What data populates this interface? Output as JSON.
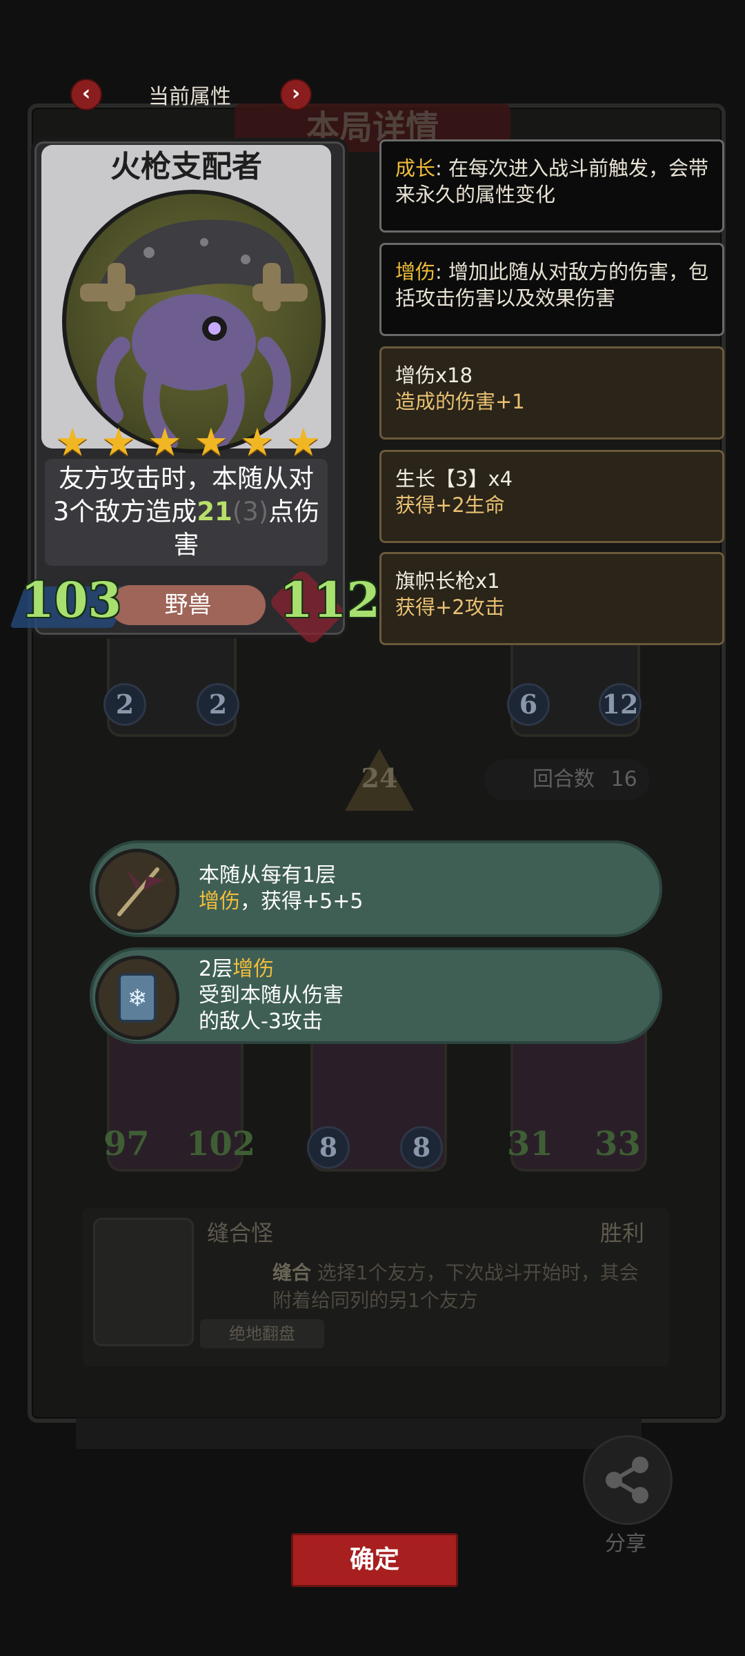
{
  "header": {
    "title": "当前属性",
    "prev_icon": "chevron-left-icon",
    "next_icon": "chevron-right-icon"
  },
  "background": {
    "banner_title": "本局详情",
    "round_label": "回合数",
    "round_value": "16",
    "tier_value": "24",
    "top_left_unit": {
      "attack": "2",
      "health": "2"
    },
    "top_right_unit": {
      "attack": "6",
      "health": "12"
    },
    "bottom_units": [
      {
        "attack": "97",
        "health": "102"
      },
      {
        "attack": "8",
        "health": "8"
      },
      {
        "attack": "31",
        "health": "33"
      }
    ],
    "opponent_name": "缝合怪",
    "result": "胜利",
    "ability_name": "缝合",
    "ability_desc": "选择1个友方，下次战斗开始时，其会附着给同列的另1个友方",
    "tag": "绝地翻盘"
  },
  "card": {
    "name": "火枪支配者",
    "stars": 6,
    "desc_line1": "友方攻击时，本随从对",
    "desc_line2_a": "3个敌方造成",
    "desc_line2_value": "21",
    "desc_line2_base": "(3)",
    "desc_line2_b": "点伤",
    "desc_line3": "害",
    "attack": "103",
    "health": "112",
    "tribe": "野兽"
  },
  "panels": [
    {
      "key": "成长",
      "text": ": 在每次进入战斗前触发，会带来永久的属性变化"
    },
    {
      "key": "增伤",
      "text": ": 增加此随从对敌方的伤害，包括攻击伤害以及效果伤害"
    }
  ],
  "effects": [
    {
      "line1": "增伤x18",
      "line2": "造成的伤害+1"
    },
    {
      "line1": "生长【3】x4",
      "line2": "获得+2生命"
    },
    {
      "line1": "旗帜长枪x1",
      "line2": "获得+2攻击"
    }
  ],
  "bubbles": [
    {
      "icon": "pennant-spear-icon",
      "line1": "本随从每有1层",
      "key": "增伤",
      "line2_rest": "，获得+5+5"
    },
    {
      "icon": "frost-book-icon",
      "line1_a": "2层",
      "key": "增伤",
      "line2": "受到本随从伤害",
      "line3": "的敌人-3攻击"
    }
  ],
  "confirm_label": "确定",
  "share_label": "分享",
  "colors": {
    "accent_red": "#a81f1f",
    "keyword_gold": "#f0bd3a",
    "stat_green": "#a8e070",
    "bubble_teal": "#3f5f55"
  }
}
